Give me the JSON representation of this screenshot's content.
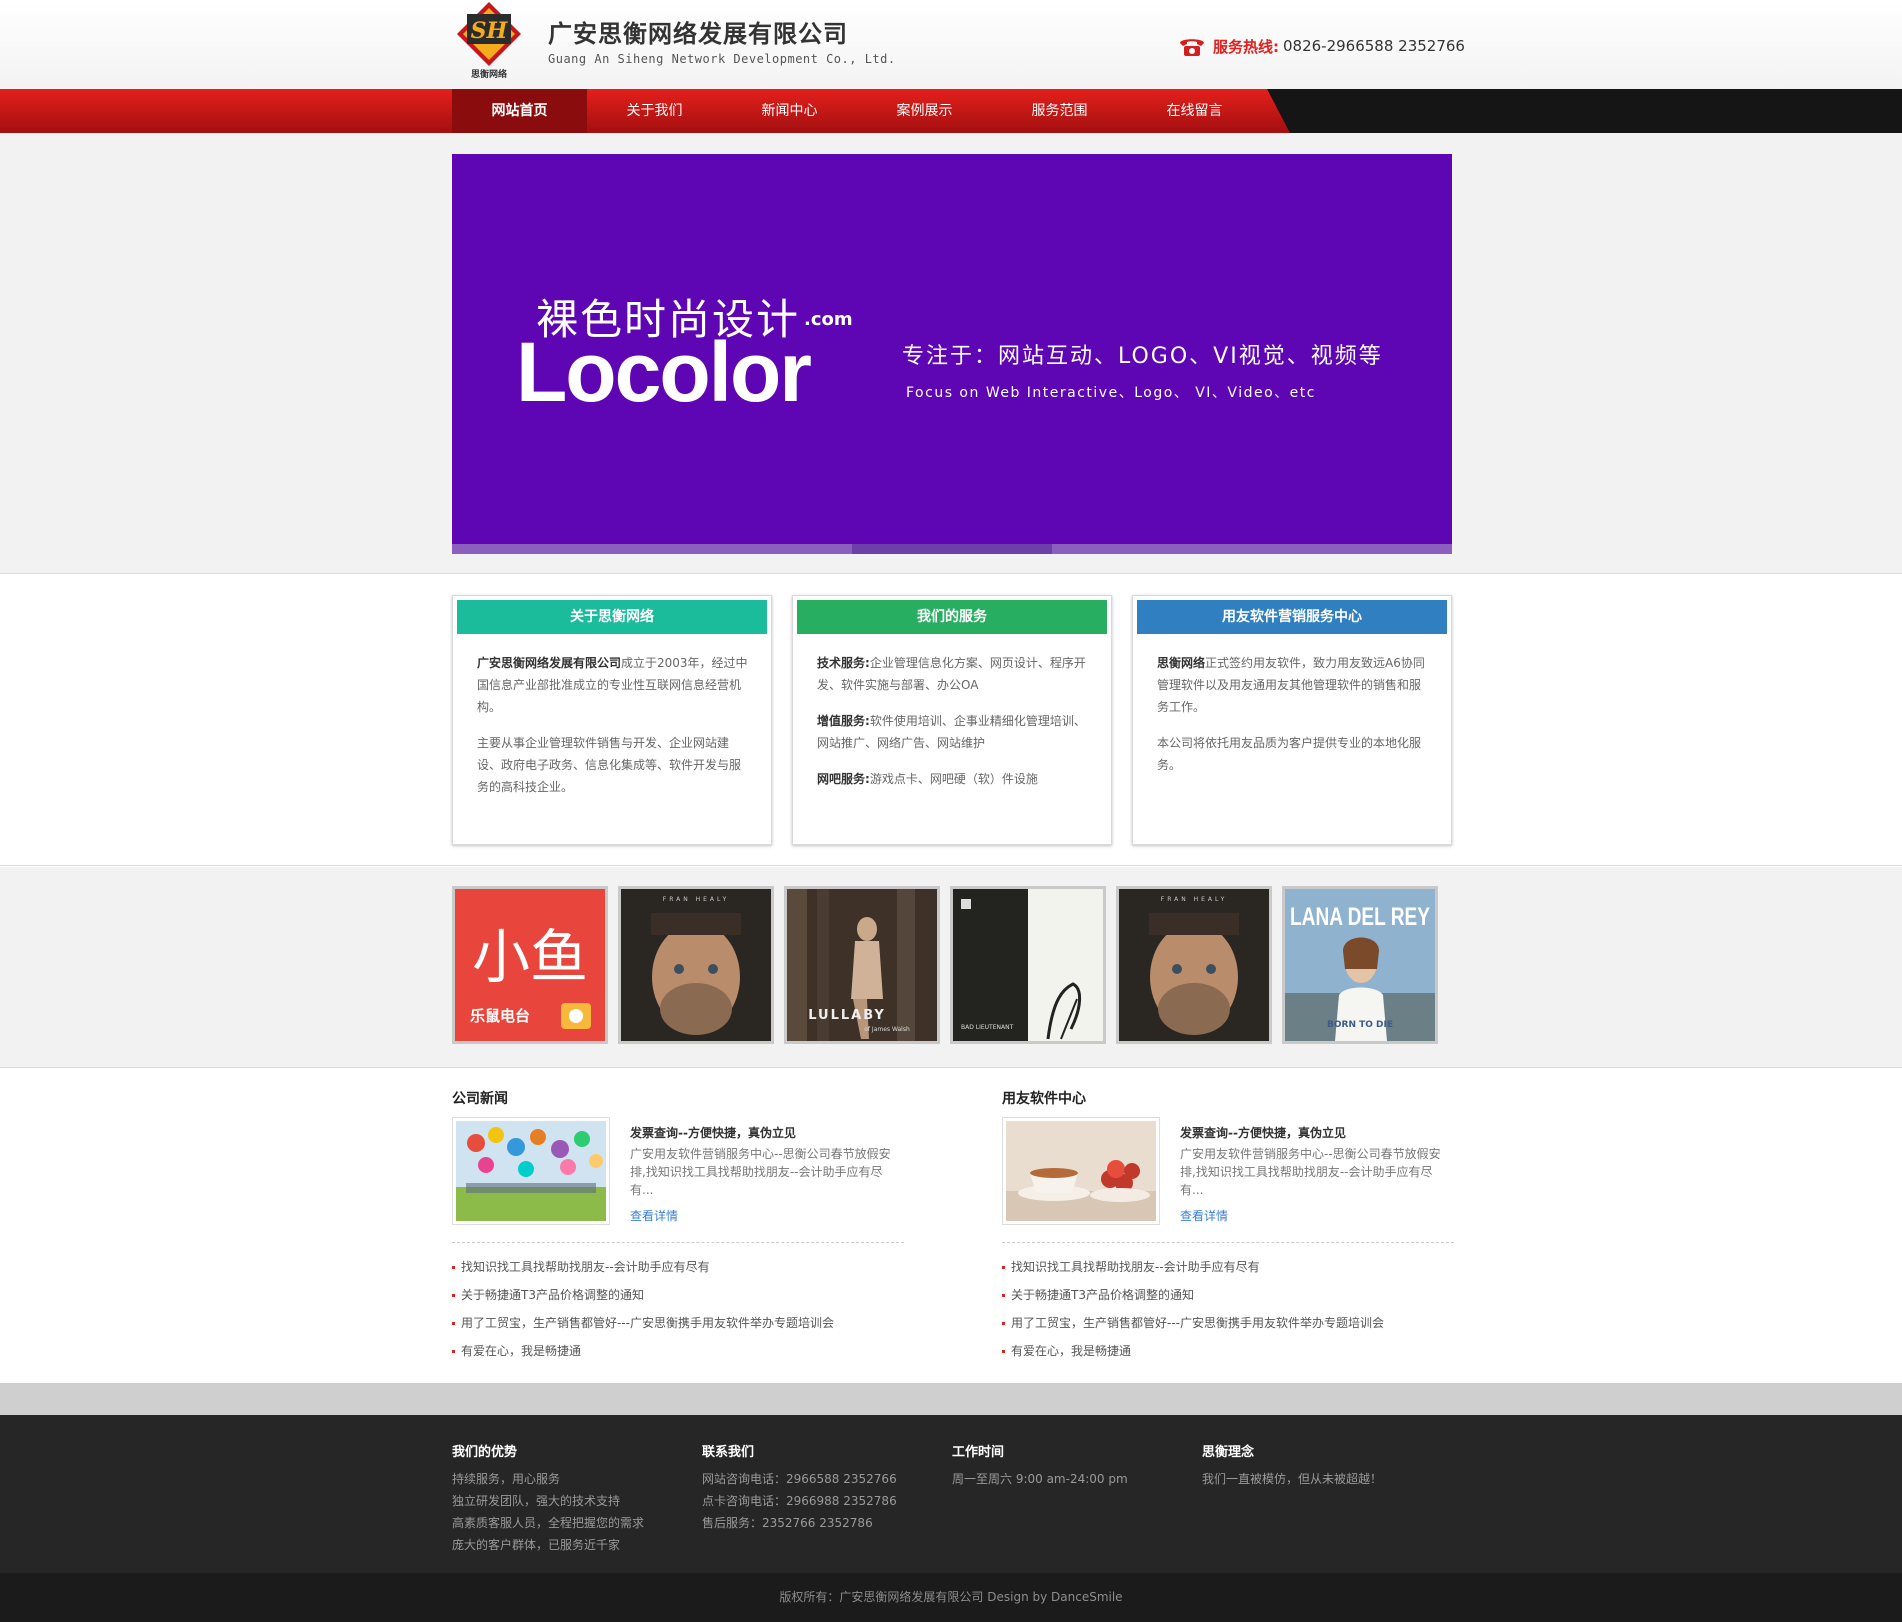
{
  "header": {
    "company_name": "广安思衡网络发展有限公司",
    "company_en": "Guang An Siheng Network Development Co., Ltd.",
    "logo_text": "SH",
    "logo_caption": "思衡网络",
    "hotline_label": "服务热线:",
    "hotline_numbers": "0826-2966588 2352766"
  },
  "nav": {
    "items": [
      {
        "label": "网站首页",
        "active": true
      },
      {
        "label": "关于我们",
        "active": false
      },
      {
        "label": "新闻中心",
        "active": false
      },
      {
        "label": "案例展示",
        "active": false
      },
      {
        "label": "服务范围",
        "active": false
      },
      {
        "label": "在线留言",
        "active": false
      }
    ]
  },
  "banner": {
    "brand_top": "裸色时尚设计",
    "brand_com": ".com",
    "brand_main": "Locolor",
    "slogan": "专注于：网站互动、LOGO、VI视觉、视频等",
    "slogan_en": "Focus on Web Interactive、Logo、 VI、Video、etc",
    "background_color": "#5e06b4",
    "slides": 5,
    "active_slide": 3
  },
  "info_boxes": [
    {
      "title": "关于思衡网络",
      "color": "#1abc9c",
      "paragraphs": [
        {
          "bold": "广安思衡网络发展有限公司",
          "text": "成立于2003年，经过中国信息产业部批准成立的专业性互联网信息经营机构。"
        },
        {
          "bold": "",
          "text": "主要从事企业管理软件销售与开发、企业网站建设、政府电子政务、信息化集成等、软件开发与服务的高科技企业。"
        }
      ]
    },
    {
      "title": "我们的服务",
      "color": "#27ae60",
      "paragraphs": [
        {
          "bold": "技术服务:",
          "text": "企业管理信息化方案、网页设计、程序开发、软件实施与部署、办公OA"
        },
        {
          "bold": "增值服务:",
          "text": "软件使用培训、企事业精细化管理培训、网站推广、网络广告、网站维护"
        },
        {
          "bold": "网吧服务:",
          "text": "游戏点卡、网吧硬（软）件设施"
        }
      ]
    },
    {
      "title": "用友软件营销服务中心",
      "color": "#2f7fc1",
      "paragraphs": [
        {
          "bold": "思衡网络",
          "text": "正式签约用友软件，致力用友致远A6协同管理软件以及用友通用友其他管理软件的销售和服务工作。"
        },
        {
          "bold": "",
          "text": "本公司将依托用友品质为客户提供专业的本地化服务。"
        }
      ]
    }
  ],
  "gallery": [
    {
      "name": "小鱼 乐鼠电台",
      "text_main": "小鱼",
      "text_sub": "乐鼠电台"
    },
    {
      "name": "Fran Healy album",
      "text_main": "FRAN HEALY"
    },
    {
      "name": "Lullaby album",
      "text_main": "LULLABY",
      "text_sub": "of James Walsh"
    },
    {
      "name": "Bad Lieutenant album",
      "text_main": "BAD LIEUTENANT"
    },
    {
      "name": "Fran Healy album 2",
      "text_main": "FRAN HEALY"
    },
    {
      "name": "Lana Del Rey Born To Die",
      "text_main": "LANA DEL REY",
      "text_sub": "BORN TO DIE"
    }
  ],
  "news": [
    {
      "section_title": "公司新闻",
      "headline": "发票查询--方便快捷，真伪立见",
      "summary": "广安用友软件营销服务中心--思衡公司春节放假安排,找知识找工具找帮助找朋友--会计助手应有尽有...",
      "more": "查看详情",
      "list": [
        "找知识找工具找帮助找朋友--会计助手应有尽有",
        "关于畅捷通T3产品价格调整的通知",
        "用了工贸宝，生产销售都管好---广安思衡携手用友软件举办专题培训会",
        "有爱在心，我是畅捷通"
      ]
    },
    {
      "section_title": "用友软件中心",
      "headline": "发票查询--方便快捷，真伪立见",
      "summary": "广安用友软件营销服务中心--思衡公司春节放假安排,找知识找工具找帮助找朋友--会计助手应有尽有...",
      "more": "查看详情",
      "list": [
        "找知识找工具找帮助找朋友--会计助手应有尽有",
        "关于畅捷通T3产品价格调整的通知",
        "用了工贸宝，生产销售都管好---广安思衡携手用友软件举办专题培训会",
        "有爱在心，我是畅捷通"
      ]
    }
  ],
  "footer": {
    "columns": [
      {
        "title": "我们的优势",
        "lines": [
          "持续服务，用心服务",
          "独立研发团队，强大的技术支持",
          "高素质客服人员，全程把握您的需求",
          "庞大的客户群体，已服务近千家"
        ]
      },
      {
        "title": "联系我们",
        "lines": [
          "网站咨询电话：2966588 2352766",
          "点卡咨询电话：2966988 2352786",
          "售后服务：2352766 2352786"
        ]
      },
      {
        "title": "工作时间",
        "lines": [
          "周一至周六 9:00 am-24:00 pm"
        ]
      },
      {
        "title": "思衡理念",
        "lines": [
          "我们一直被模仿，但从未被超越！"
        ]
      }
    ],
    "copyright": "版权所有：广安思衡网络发展有限公司 Design by DanceSmile"
  },
  "colors": {
    "nav_red": "#e4201c",
    "accent_red": "#e2201f",
    "link_blue": "#3b7fd0",
    "footer_bg": "#262626"
  }
}
